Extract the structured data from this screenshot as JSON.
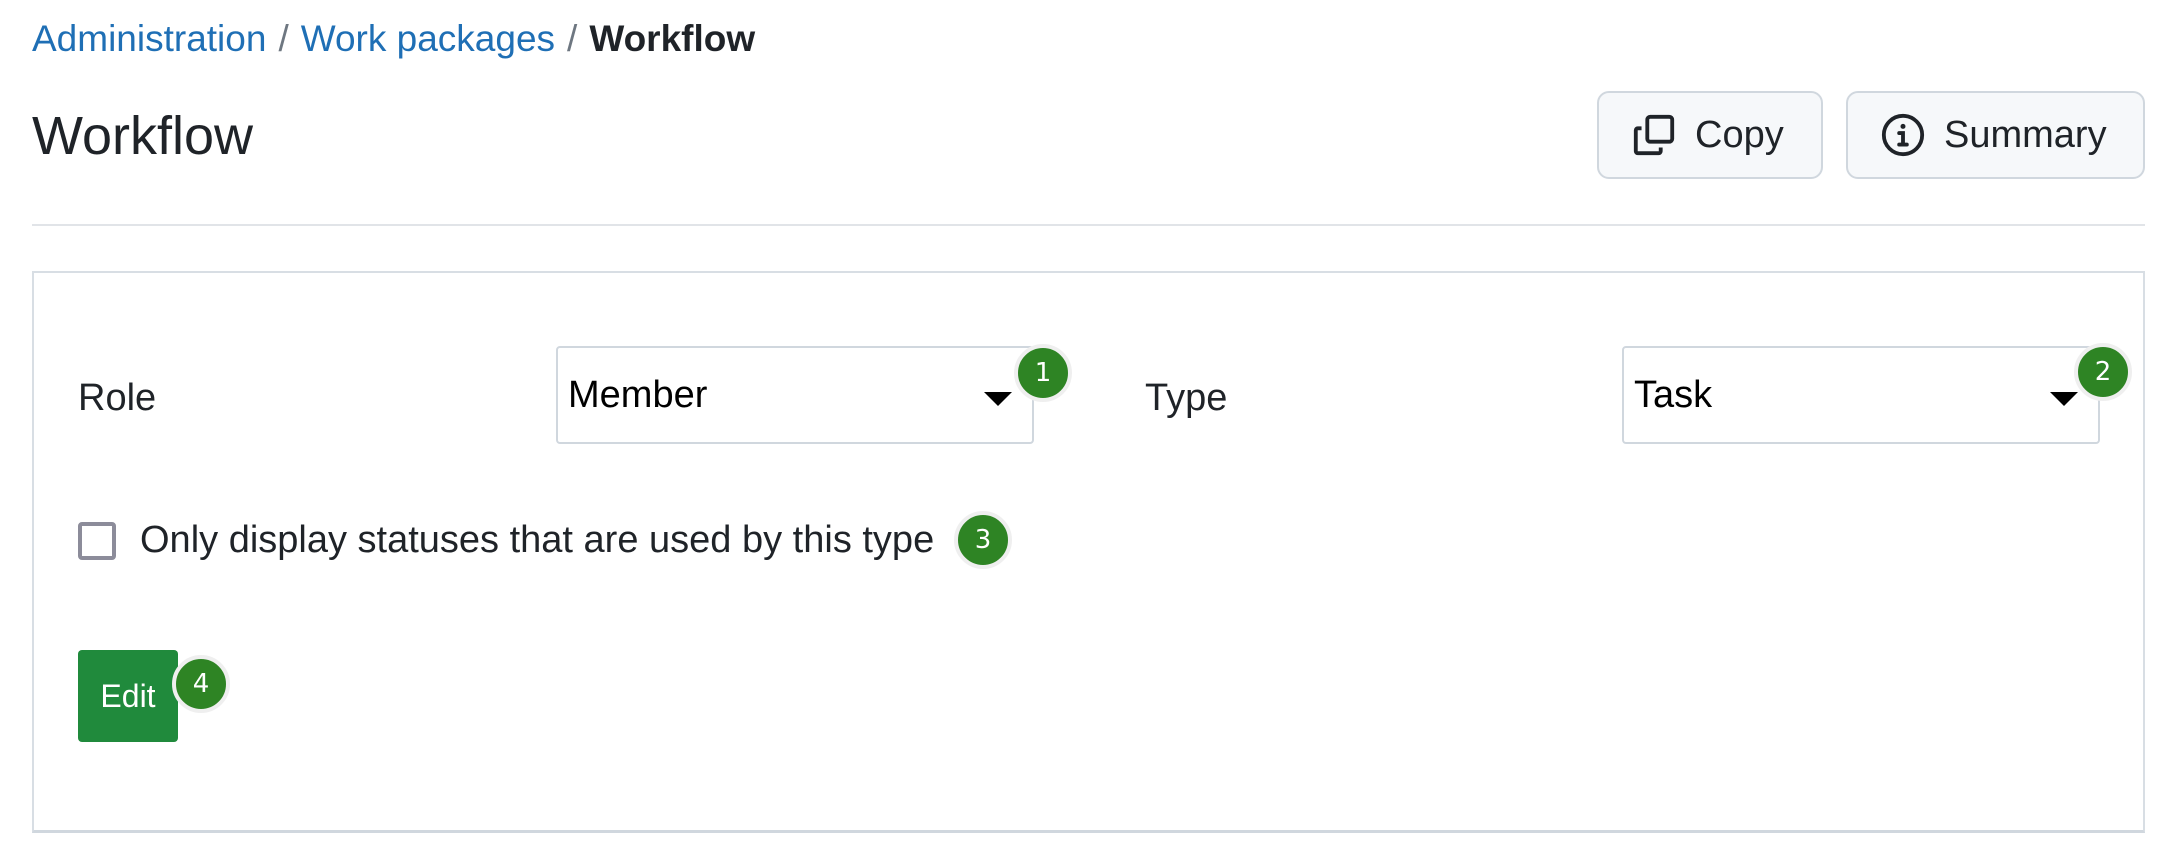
{
  "breadcrumb": {
    "items": [
      {
        "label": "Administration"
      },
      {
        "label": "Work packages"
      },
      {
        "label": "Workflow"
      }
    ],
    "separator": "/"
  },
  "header": {
    "title": "Workflow",
    "copy_label": "Copy",
    "copy_icon": "copy-icon",
    "summary_label": "Summary",
    "summary_icon": "info-icon"
  },
  "form": {
    "role_label": "Role",
    "role_value": "Member",
    "type_label": "Type",
    "type_value": "Task",
    "checkbox_label": "Only display statuses that are used by this type",
    "checkbox_checked": false,
    "edit_label": "Edit"
  },
  "badges": [
    "1",
    "2",
    "3",
    "4"
  ],
  "colors": {
    "link": "#1f6fb5",
    "primary_button": "#208a3c",
    "badge": "#2e8424"
  }
}
